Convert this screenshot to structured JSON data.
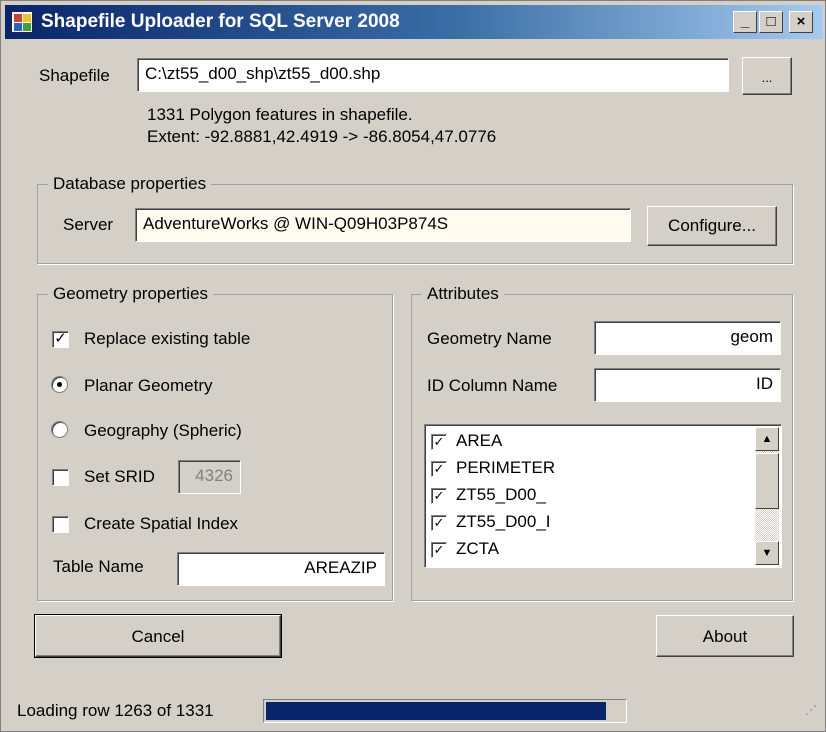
{
  "window": {
    "title": "Shapefile Uploader for SQL Server 2008",
    "minimize_glyph": "_",
    "maximize_glyph": "□",
    "close_glyph": "×"
  },
  "shapefile": {
    "label": "Shapefile",
    "path": "C:\\zt55_d00_shp\\zt55_d00.shp",
    "browse_label": "...",
    "info_line1": "1331 Polygon features in shapefile.",
    "info_line2": "Extent: -92.8881,42.4919 -> -86.8054,47.0776"
  },
  "database": {
    "legend": "Database properties",
    "server_label": "Server",
    "server_value": "AdventureWorks @ WIN-Q09H03P874S",
    "configure_label": "Configure..."
  },
  "geometry": {
    "legend": "Geometry properties",
    "replace_label": "Replace existing table",
    "replace_checked": true,
    "planar_label": "Planar Geometry",
    "planar_selected": true,
    "geography_label": "Geography (Spheric)",
    "geography_selected": false,
    "srid_label": "Set SRID",
    "srid_checked": false,
    "srid_value": "4326",
    "spatial_index_label": "Create Spatial Index",
    "spatial_index_checked": false,
    "table_name_label": "Table Name",
    "table_name_value": "AREAZIP"
  },
  "attributes": {
    "legend": "Attributes",
    "geometry_name_label": "Geometry Name",
    "geometry_name_value": "geom",
    "id_column_label": "ID Column Name",
    "id_column_value": "ID",
    "columns": [
      {
        "name": "AREA",
        "checked": true
      },
      {
        "name": "PERIMETER",
        "checked": true
      },
      {
        "name": "ZT55_D00_",
        "checked": true
      },
      {
        "name": "ZT55_D00_I",
        "checked": true
      },
      {
        "name": "ZCTA",
        "checked": true
      }
    ]
  },
  "buttons": {
    "cancel": "Cancel",
    "about": "About"
  },
  "status": {
    "text": "Loading row 1263 of 1331",
    "progress_fraction": 0.949
  },
  "colors": {
    "titlebar_start": "#0a246a",
    "progress_fill": "#0a246a",
    "server_field_bg": "#fffbf0"
  }
}
